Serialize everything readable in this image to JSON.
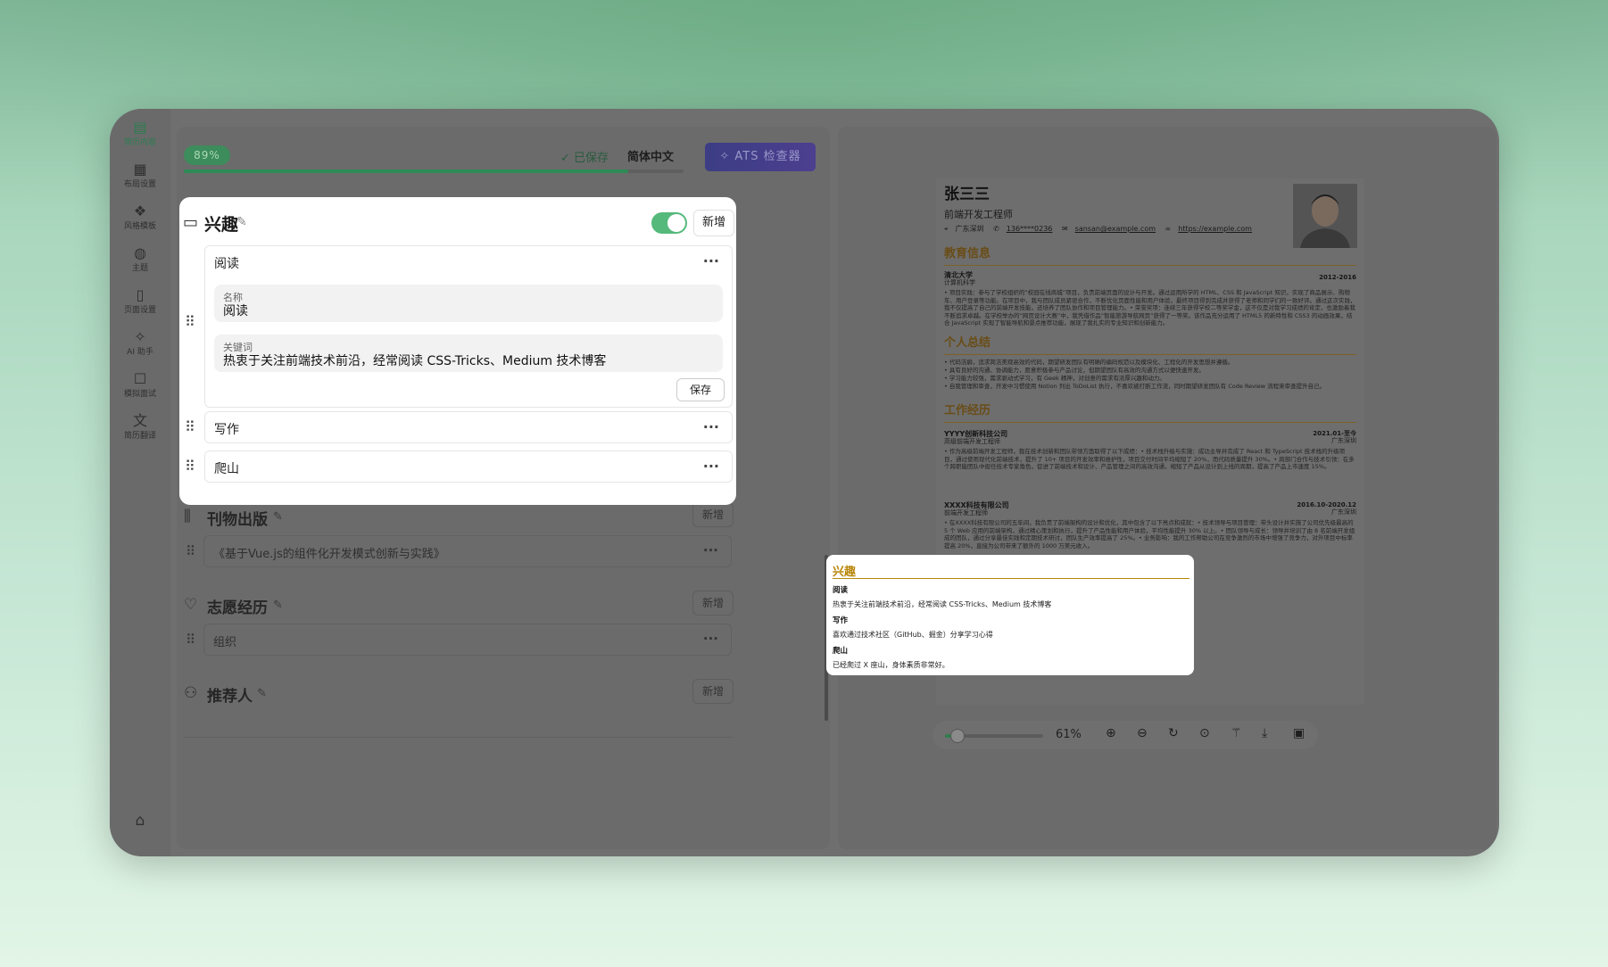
{
  "sidebar": {
    "items": [
      {
        "label": "简历内容",
        "icon": "document-list-icon",
        "glyph": "▤",
        "active": true
      },
      {
        "label": "布局设置",
        "icon": "layout-icon",
        "glyph": "▦"
      },
      {
        "label": "风格模板",
        "icon": "template-icon",
        "glyph": "❖"
      },
      {
        "label": "主题",
        "icon": "palette-icon",
        "glyph": "◍"
      },
      {
        "label": "页面设置",
        "icon": "page-icon",
        "glyph": "▯"
      },
      {
        "label": "AI 助手",
        "icon": "sparkles-icon",
        "glyph": "✧"
      },
      {
        "label": "模拟面试",
        "icon": "chat-icon",
        "glyph": "☐"
      },
      {
        "label": "简历翻译",
        "icon": "translate-icon",
        "glyph": "文"
      }
    ],
    "home_glyph": "⌂"
  },
  "editor": {
    "progress": 0.89,
    "progress_label": "89%",
    "saved_label": "已保存",
    "language_label": "简体中文",
    "ats_label": "ATS 检查器",
    "interests": {
      "title": "兴趣",
      "enabled": true,
      "add_label": "新增",
      "items": [
        {
          "title": "阅读",
          "expanded": true,
          "name_label": "名称",
          "name_value": "阅读",
          "keyword_label": "关键词",
          "keyword_value": "热衷于关注前端技术前沿，经常阅读 CSS-Tricks、Medium 技术博客",
          "save_label": "保存"
        },
        {
          "title": "写作"
        },
        {
          "title": "爬山"
        }
      ]
    },
    "sections": [
      {
        "title": "刊物出版",
        "add_label": "新增",
        "item": "《基于Vue.js的组件化开发模式创新与实践》",
        "icon": "books-icon",
        "glyph": "⫼"
      },
      {
        "title": "志愿经历",
        "add_label": "新增",
        "item": "组织",
        "icon": "heart-icon",
        "glyph": "♡"
      },
      {
        "title": "推荐人",
        "add_label": "新增",
        "icon": "users-icon",
        "glyph": "⚇"
      }
    ]
  },
  "resume": {
    "name": "张三三",
    "title": "前端开发工程师",
    "contact": {
      "location": "广东深圳",
      "phone": "136****0236",
      "email": "sansan@example.com",
      "website": "https://example.com"
    },
    "education": {
      "heading": "教育信息",
      "school": "清北大学",
      "major": "计算机科学",
      "period": "2012-2016",
      "text": "• 项目实践：参与了学校组织的“校园在线商城”项目，负责前端页面的设计与开发。通过运用所学的 HTML、CSS 和 JavaScript 知识，实现了商品展示、购物车、用户登录等功能。在项目中，我与团队成员紧密合作，不断优化页面性能和用户体验，最终项目得到完成并获得了老师和同学们的一致好评。通过这次实践，我不仅提高了自己的前端开发技能，还培养了团队协作和项目管理能力。• 荣誉奖项：连续三年获得学校二等奖学金，这不仅是对我学习成绩的肯定，也激励着我不断追求卓越。在学校举办的“网页设计大赛”中，我凭借作品“智能旅游导航网页”获得了一等奖。该作品充分运用了 HTML5 的新特性和 CSS3 的动画效果，结合 JavaScript 实现了智能导航和景点推荐功能，展现了我扎实的专业知识和创新能力。"
    },
    "summary": {
      "heading": "个人总结",
      "items": [
        "代码洁癖，追求简洁美观高效的代码，期望研发团队有明确的编码规范以及模块化、工程化的开发思想并遵循。",
        "具有良好的沟通、协调能力，愿意积极参与产品讨论，但期望团队有高效的沟通方式以便快速开发。",
        "学习能力较强，需求驱动式学习，有 Geek 精神，对创意的需求有浓厚兴趣和动力。",
        "自我管理和审查，开发中习惯使用 Notion 列出 ToDoList 执行，不喜欢被打断工作流，同时期望研发团队有 Code Review 流程来审查提升自己。"
      ]
    },
    "work": {
      "heading": "工作经历",
      "jobs": [
        {
          "company": "YYYY创新科技公司",
          "role": "高级前端开发工程师",
          "period": "2021.01-至今",
          "location": "广东深圳",
          "text": "• 作为高级前端开发工程师，我在技术创新和团队带领方面取得了以下成绩：• 技术栈升级与实施：成功主导并完成了 React 和 TypeScript 技术栈的升级项目，通过使用现代化前端技术，提升了 10+ 项目的开发效率和维护性，项目交付时间平均缩短了 20%，而代码质量提升 30%。• 跨部门合作与技术引领：在多个跨职能团队中担任技术专家角色，促进了前端技术和设计、产品管理之间的高效沟通，缩短了产品从设计到上线的周期，提高了产品上市速度 15%。"
        },
        {
          "company": "XXXX科技有限公司",
          "role": "前端开发工程师",
          "period": "2016.10-2020.12",
          "location": "广东深圳",
          "text": "• 在XXXX科技有限公司的五年间，我负责了前端架构的设计和优化，其中包含了以下亮点和成就：• 技术领导与项目管理：带头设计并实施了公司优先级最高的 5 个 Web 应用的前端架构，通过精心策划和执行，提升了产品性能和用户体验，平均性能提升 30% 以上。• 团队领导与成长：领导并培训了由 8 名前端开发组成的团队，通过分享最佳实践和定期技术研讨，团队生产效率提高了 25%。• 业务影响：我的工作帮助公司在竞争激烈的市场中增强了竞争力，对外项目中标率提高 20%，直接为公司带来了额外的 1000 万美元收入。"
        }
      ]
    },
    "interests": {
      "heading": "兴趣",
      "items": [
        {
          "name": "阅读",
          "desc": "热衷于关注前端技术前沿，经常阅读 CSS-Tricks、Medium 技术博客"
        },
        {
          "name": "写作",
          "desc": "喜欢通过技术社区（GitHub、掘金）分享学习心得"
        },
        {
          "name": "爬山",
          "desc": "已经爬过 X 座山，身体素质非常好。"
        }
      ]
    }
  },
  "zoom": {
    "level": 0.61,
    "label": "61%"
  },
  "colors": {
    "accent": "#55b97c",
    "resume_accent": "#b8860b",
    "ats": "#3c3d84"
  }
}
